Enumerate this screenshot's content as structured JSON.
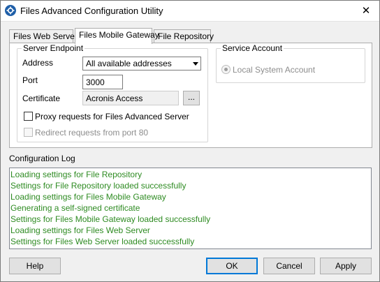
{
  "window": {
    "title": "Files Advanced Configuration Utility",
    "close_glyph": "✕"
  },
  "tabs": [
    {
      "label": "Files Web Server",
      "active": false
    },
    {
      "label": "Files Mobile Gateway",
      "active": true
    },
    {
      "label": "File Repository",
      "active": false
    }
  ],
  "server_endpoint": {
    "legend": "Server Endpoint",
    "address_label": "Address",
    "address_value": "All available addresses",
    "port_label": "Port",
    "port_value": "3000",
    "certificate_label": "Certificate",
    "certificate_value": "Acronis Access",
    "browse_label": "...",
    "proxy_label": "Proxy requests for Files Advanced Server",
    "proxy_checked": false,
    "redirect_label": "Redirect requests from port 80",
    "redirect_checked": false,
    "redirect_enabled": false
  },
  "service_account": {
    "legend": "Service Account",
    "local_system_label": "Local System Account",
    "local_system_selected": true,
    "enabled": false
  },
  "configuration_log": {
    "label": "Configuration Log",
    "text_color": "#2e8b22",
    "lines": [
      "Loading settings for File Repository",
      "Settings for File Repository loaded successfully",
      "Loading settings for Files Mobile Gateway",
      "Generating a self-signed certificate",
      "Settings for Files Mobile Gateway loaded successfully",
      "Loading settings for Files Web Server",
      "Settings for Files Web Server loaded successfully"
    ]
  },
  "buttons": {
    "help": "Help",
    "ok": "OK",
    "cancel": "Cancel",
    "apply": "Apply"
  },
  "colors": {
    "app_icon": "#1f5fa8",
    "default_button_border": "#0078d7"
  }
}
